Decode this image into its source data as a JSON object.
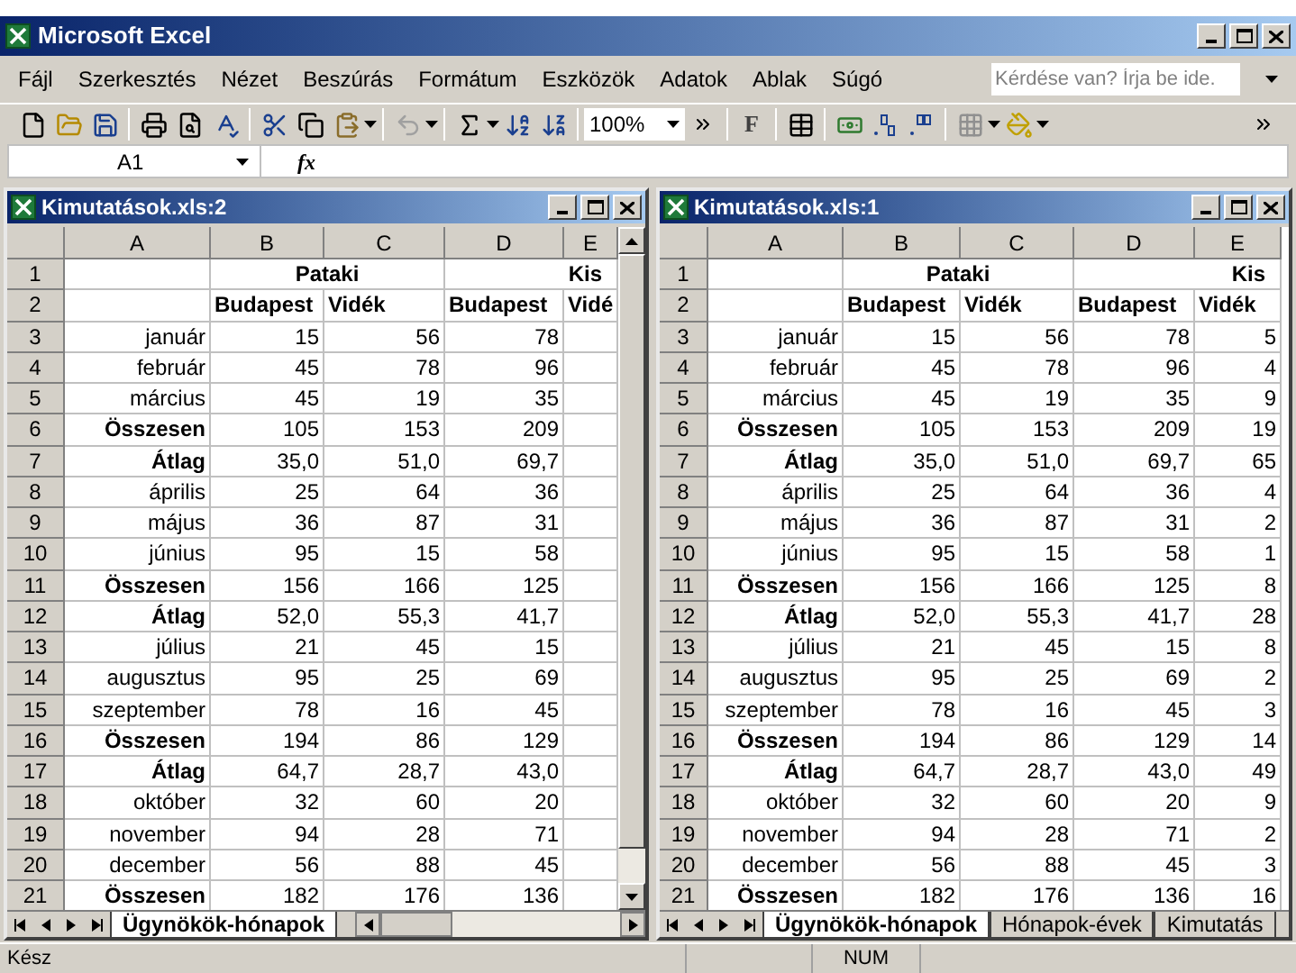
{
  "app": {
    "title": "Microsoft Excel"
  },
  "menu": [
    "Fájl",
    "Szerkesztés",
    "Nézet",
    "Beszúrás",
    "Formátum",
    "Eszközök",
    "Adatok",
    "Ablak",
    "Súgó"
  ],
  "help_box": {
    "placeholder": "Kérdése van? Írja be ide."
  },
  "toolbar": {
    "zoom": "100%",
    "bold_label": "F"
  },
  "formula_bar": {
    "name_box": "A1",
    "function_label": "fx"
  },
  "windows": [
    {
      "title": "Kimutatások.xls:2",
      "columns": [
        "A",
        "B",
        "C",
        "D",
        "E"
      ],
      "rows": [
        {
          "num": "1",
          "kind": "group",
          "groups": [
            "Pataki",
            "Kis"
          ]
        },
        {
          "num": "2",
          "kind": "header",
          "cells": [
            "Budapest",
            "Vidék",
            "Budapest",
            "Vidé"
          ]
        },
        {
          "num": "3",
          "kind": "data",
          "label": "január",
          "values": [
            "15",
            "56",
            "78"
          ]
        },
        {
          "num": "4",
          "kind": "data",
          "label": "február",
          "values": [
            "45",
            "78",
            "96"
          ]
        },
        {
          "num": "5",
          "kind": "data",
          "label": "március",
          "values": [
            "45",
            "19",
            "35"
          ]
        },
        {
          "num": "6",
          "kind": "summary",
          "label": "Összesen",
          "values": [
            "105",
            "153",
            "209"
          ]
        },
        {
          "num": "7",
          "kind": "summary",
          "label": "Átlag",
          "values": [
            "35,0",
            "51,0",
            "69,7"
          ]
        },
        {
          "num": "8",
          "kind": "data",
          "label": "április",
          "values": [
            "25",
            "64",
            "36"
          ]
        },
        {
          "num": "9",
          "kind": "data",
          "label": "május",
          "values": [
            "36",
            "87",
            "31"
          ]
        },
        {
          "num": "10",
          "kind": "data",
          "label": "június",
          "values": [
            "95",
            "15",
            "58"
          ]
        },
        {
          "num": "11",
          "kind": "summary",
          "label": "Összesen",
          "values": [
            "156",
            "166",
            "125"
          ]
        },
        {
          "num": "12",
          "kind": "summary",
          "label": "Átlag",
          "values": [
            "52,0",
            "55,3",
            "41,7"
          ]
        },
        {
          "num": "13",
          "kind": "data",
          "label": "július",
          "values": [
            "21",
            "45",
            "15"
          ]
        },
        {
          "num": "14",
          "kind": "data",
          "label": "augusztus",
          "values": [
            "95",
            "25",
            "69"
          ]
        },
        {
          "num": "15",
          "kind": "data",
          "label": "szeptember",
          "values": [
            "78",
            "16",
            "45"
          ]
        },
        {
          "num": "16",
          "kind": "summary",
          "label": "Összesen",
          "values": [
            "194",
            "86",
            "129"
          ]
        },
        {
          "num": "17",
          "kind": "summary",
          "label": "Átlag",
          "values": [
            "64,7",
            "28,7",
            "43,0"
          ]
        },
        {
          "num": "18",
          "kind": "data",
          "label": "október",
          "values": [
            "32",
            "60",
            "20"
          ]
        },
        {
          "num": "19",
          "kind": "data",
          "label": "november",
          "values": [
            "94",
            "28",
            "71"
          ]
        },
        {
          "num": "20",
          "kind": "data",
          "label": "december",
          "values": [
            "56",
            "88",
            "45"
          ]
        },
        {
          "num": "21",
          "kind": "summary",
          "label": "Összesen",
          "values": [
            "182",
            "176",
            "136"
          ]
        }
      ],
      "tabs": [
        {
          "label": "Ügynökök-hónapok",
          "selected": true
        }
      ]
    },
    {
      "title": "Kimutatások.xls:1",
      "columns": [
        "A",
        "B",
        "C",
        "D",
        "E"
      ],
      "rows": [
        {
          "num": "1",
          "kind": "group",
          "groups": [
            "Pataki",
            "Kis"
          ]
        },
        {
          "num": "2",
          "kind": "header",
          "cells": [
            "Budapest",
            "Vidék",
            "Budapest",
            "Vidék"
          ]
        },
        {
          "num": "3",
          "kind": "data",
          "label": "január",
          "values": [
            "15",
            "56",
            "78",
            "5"
          ]
        },
        {
          "num": "4",
          "kind": "data",
          "label": "február",
          "values": [
            "45",
            "78",
            "96",
            "4"
          ]
        },
        {
          "num": "5",
          "kind": "data",
          "label": "március",
          "values": [
            "45",
            "19",
            "35",
            "9"
          ]
        },
        {
          "num": "6",
          "kind": "summary",
          "label": "Összesen",
          "values": [
            "105",
            "153",
            "209",
            "19"
          ]
        },
        {
          "num": "7",
          "kind": "summary",
          "label": "Átlag",
          "values": [
            "35,0",
            "51,0",
            "69,7",
            "65"
          ]
        },
        {
          "num": "8",
          "kind": "data",
          "label": "április",
          "values": [
            "25",
            "64",
            "36",
            "4"
          ]
        },
        {
          "num": "9",
          "kind": "data",
          "label": "május",
          "values": [
            "36",
            "87",
            "31",
            "2"
          ]
        },
        {
          "num": "10",
          "kind": "data",
          "label": "június",
          "values": [
            "95",
            "15",
            "58",
            "1"
          ]
        },
        {
          "num": "11",
          "kind": "summary",
          "label": "Összesen",
          "values": [
            "156",
            "166",
            "125",
            "8"
          ]
        },
        {
          "num": "12",
          "kind": "summary",
          "label": "Átlag",
          "values": [
            "52,0",
            "55,3",
            "41,7",
            "28"
          ]
        },
        {
          "num": "13",
          "kind": "data",
          "label": "július",
          "values": [
            "21",
            "45",
            "15",
            "8"
          ]
        },
        {
          "num": "14",
          "kind": "data",
          "label": "augusztus",
          "values": [
            "95",
            "25",
            "69",
            "2"
          ]
        },
        {
          "num": "15",
          "kind": "data",
          "label": "szeptember",
          "values": [
            "78",
            "16",
            "45",
            "3"
          ]
        },
        {
          "num": "16",
          "kind": "summary",
          "label": "Összesen",
          "values": [
            "194",
            "86",
            "129",
            "14"
          ]
        },
        {
          "num": "17",
          "kind": "summary",
          "label": "Átlag",
          "values": [
            "64,7",
            "28,7",
            "43,0",
            "49"
          ]
        },
        {
          "num": "18",
          "kind": "data",
          "label": "október",
          "values": [
            "32",
            "60",
            "20",
            "9"
          ]
        },
        {
          "num": "19",
          "kind": "data",
          "label": "november",
          "values": [
            "94",
            "28",
            "71",
            "2"
          ]
        },
        {
          "num": "20",
          "kind": "data",
          "label": "december",
          "values": [
            "56",
            "88",
            "45",
            "3"
          ]
        },
        {
          "num": "21",
          "kind": "summary",
          "label": "Összesen",
          "values": [
            "182",
            "176",
            "136",
            "16"
          ]
        }
      ],
      "tabs": [
        {
          "label": "Ügynökök-hónapok",
          "selected": true
        },
        {
          "label": "Hónapok-évek",
          "selected": false
        },
        {
          "label": "Kimutatás",
          "selected": false
        }
      ]
    }
  ],
  "status_bar": {
    "message": "Kész",
    "indicator": "NUM"
  }
}
